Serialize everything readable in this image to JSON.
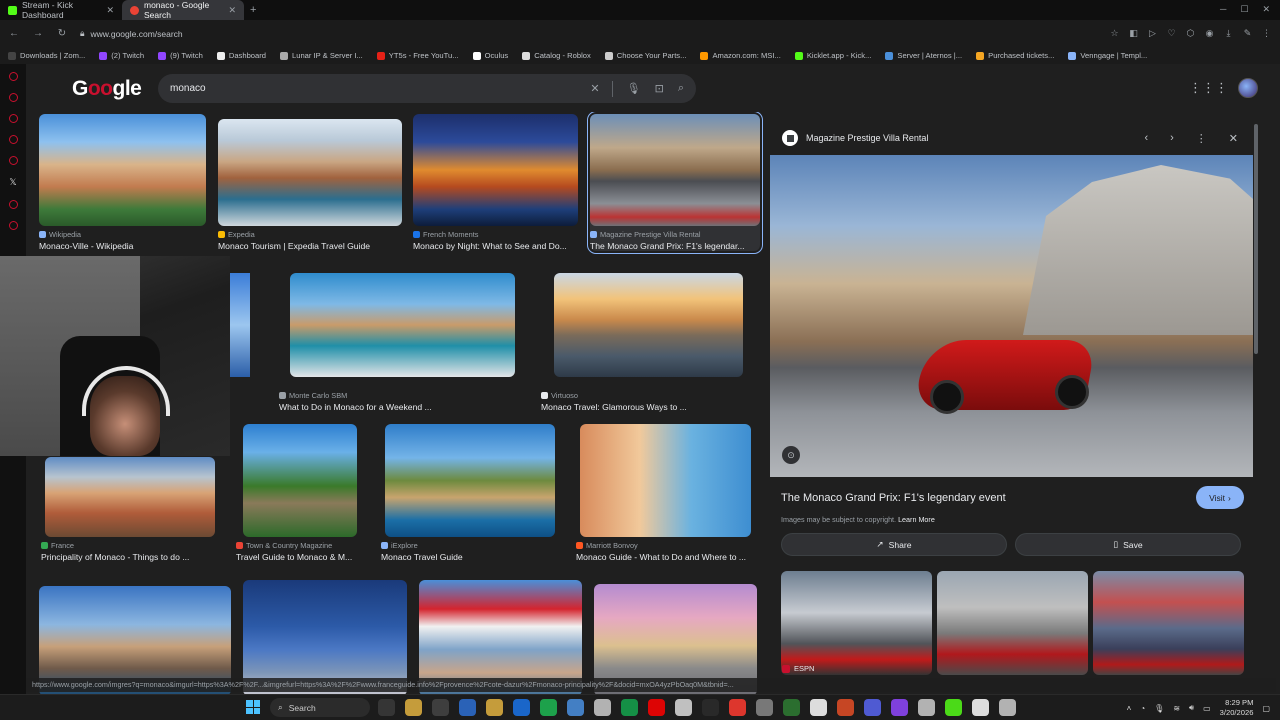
{
  "browser": {
    "tabs": [
      {
        "title": "Stream - Kick Dashboard",
        "active": false,
        "color": "#53fc18"
      },
      {
        "title": "monaco - Google Search",
        "active": true,
        "color": "#ea4335"
      }
    ],
    "url": "www.google.com/search",
    "bookmarks": [
      {
        "label": "Downloads | Zom...",
        "color": "#444"
      },
      {
        "label": "(2) Twitch",
        "color": "#9146ff"
      },
      {
        "label": "(9) Twitch",
        "color": "#9146ff"
      },
      {
        "label": "Dashboard",
        "color": "#eee"
      },
      {
        "label": "Lunar IP & Server I...",
        "color": "#aaa"
      },
      {
        "label": "YT5s - Free YouTu...",
        "color": "#e62117"
      },
      {
        "label": "Oculus",
        "color": "#fff"
      },
      {
        "label": "Catalog - Roblox",
        "color": "#ddd"
      },
      {
        "label": "Choose Your Parts...",
        "color": "#ccc"
      },
      {
        "label": "Amazon.com: MSI...",
        "color": "#ff9900"
      },
      {
        "label": "Kicklet.app - Kick...",
        "color": "#53fc18"
      },
      {
        "label": "Server | Aternos |...",
        "color": "#4a8fd9"
      },
      {
        "label": "Purchased tickets...",
        "color": "#f5a623"
      },
      {
        "label": "Venngage | Templ...",
        "color": "#8ab4f8"
      }
    ]
  },
  "google": {
    "logo_prefix": "G",
    "logo_mid": "oo",
    "logo_suffix": "gle",
    "query": "monaco"
  },
  "results": {
    "row1": [
      {
        "source": "Wikipedia",
        "caption": "Monaco-Ville - Wikipedia",
        "img": "img-coast"
      },
      {
        "source": "Expedia",
        "caption": "Monaco Tourism | Expedia Travel Guide",
        "img": "img-harbor"
      },
      {
        "source": "French Moments",
        "caption": "Monaco by Night: What to See and Do...",
        "img": "img-night"
      },
      {
        "source": "Magazine Prestige Villa Rental",
        "caption": "The Monaco Grand Prix: F1's legendar...",
        "img": "img-race"
      }
    ],
    "row2": [
      {
        "source": "Monte Carlo SBM",
        "caption": "What to Do in Monaco for a Weekend ...",
        "img": "img-palm"
      },
      {
        "source": "Virtuoso",
        "caption": "Monaco Travel: Glamorous Ways to ...",
        "img": "img-sunset"
      }
    ],
    "row3": [
      {
        "source": "France",
        "caption": "Principality of Monaco - Things to do ...",
        "img": "img-aerial"
      },
      {
        "source": "Town & Country Magazine",
        "caption": "Travel Guide to Monaco & M...",
        "img": "img-casino"
      },
      {
        "source": "iExplore",
        "caption": "Monaco Travel Guide",
        "img": "img-rock"
      },
      {
        "source": "Marriott Bonvoy",
        "caption": "Monaco Guide - What to Do and Where to ...",
        "img": "img-street"
      }
    ],
    "row4": [
      {
        "img": "img-bay"
      },
      {
        "img": "img-lights"
      },
      {
        "img": "img-flag"
      },
      {
        "img": "img-pink"
      }
    ]
  },
  "preview": {
    "site": "Magazine Prestige Villa Rental",
    "title": "The Monaco Grand Prix: F1's legendary event",
    "visit_label": "Visit",
    "copyright": "Images may be subject to copyright.",
    "learn_more": "Learn More",
    "share_label": "Share",
    "save_label": "Save",
    "related_source": "ESPN"
  },
  "status_url": "https://www.google.com/imgres?q=monaco&imgurl=https%3A%2F%2F...&imgrefurl=https%3A%2F%2Fwww.franceguide.info%2Fprovence%2Fcote-dazur%2Fmonaco-principality%2F&docid=mxOA4yzPbOaq0M&tbnid=...",
  "taskbar": {
    "search_label": "Search",
    "time": "8:29 PM",
    "date": "3/20/2026"
  }
}
